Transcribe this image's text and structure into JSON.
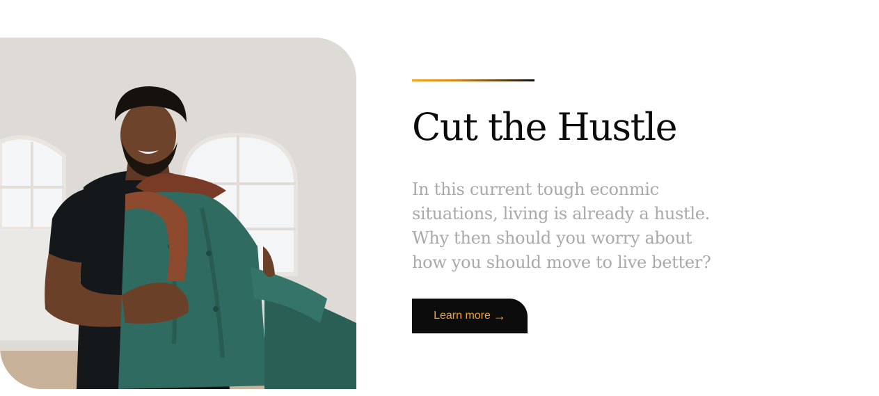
{
  "hero": {
    "title": "Cut the Hustle",
    "description": "In this current tough econmic situations, living is already a hustle. Why then should you worry about how you should move to live better?",
    "cta_label": "Learn more",
    "cta_arrow": "→"
  },
  "colors": {
    "accent": "#f5a623",
    "button_bg": "#0c0c0c",
    "title": "#0b0b0b",
    "description": "#a9a9a9"
  },
  "image": {
    "subject": "man carrying green velvet armchair"
  }
}
